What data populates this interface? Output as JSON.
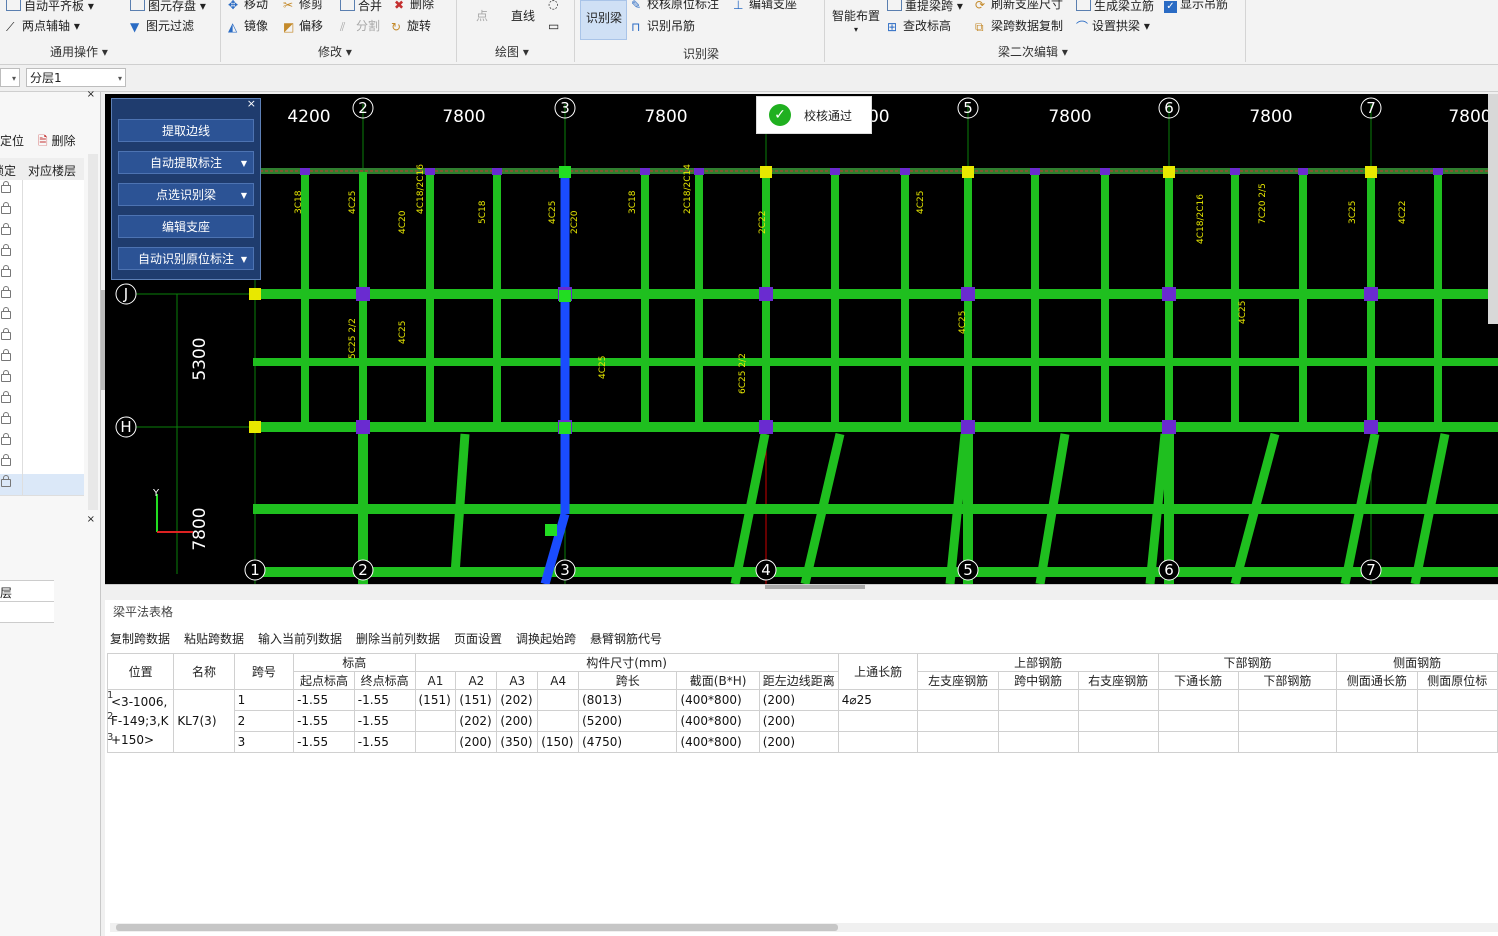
{
  "ribbon": {
    "groups": [
      {
        "label": "通用操作",
        "items": [
          "自动平齐板",
          "两点辅轴",
          "图元存盘",
          "图元过滤"
        ]
      },
      {
        "label": "修改",
        "items": [
          "移动",
          "修剪",
          "合并",
          "删除",
          "镜像",
          "偏移",
          "分割",
          "旋转"
        ]
      },
      {
        "label": "绘图",
        "items": [
          "点",
          "直线"
        ]
      },
      {
        "label": "识别梁",
        "items": [
          "识别梁",
          "校核原位标注",
          "编辑支座",
          "识别吊筋"
        ]
      },
      {
        "label": "梁二次编辑",
        "items": [
          "智能布置",
          "重提梁跨",
          "查改标高",
          "刷新支座尺寸",
          "梁跨数据复制",
          "生成梁立筋",
          "设置拱梁",
          "显示吊筋"
        ]
      }
    ]
  },
  "layer_combo": "分层1",
  "left_panel": {
    "btn_locate": "定位",
    "btn_delete": "删除",
    "col_lock": "锁定",
    "col_floor": "对应楼层",
    "lower_label": "层"
  },
  "tool_panel": {
    "buttons": [
      "提取边线",
      "自动提取标注",
      "点选识别梁",
      "编辑支座",
      "自动识别原位标注"
    ]
  },
  "toast": {
    "text": "校核通过"
  },
  "drawing": {
    "top_dims": [
      "4200",
      "7800",
      "7800",
      "7800",
      "7800",
      "7800",
      "7800"
    ],
    "top_axes": [
      "2",
      "3",
      "5",
      "6",
      "7"
    ],
    "bottom_axes": [
      "1",
      "2",
      "3",
      "4",
      "5",
      "6",
      "7"
    ],
    "row_axes": [
      "J",
      "H"
    ],
    "side_dims": [
      "5300",
      "7800"
    ]
  },
  "table": {
    "title": "梁平法表格",
    "actions": [
      "复制跨数据",
      "粘贴跨数据",
      "输入当前列数据",
      "删除当前列数据",
      "页面设置",
      "调换起始跨",
      "悬臂钢筋代号"
    ],
    "header_top": {
      "pos": "位置",
      "name": "名称",
      "span": "跨号",
      "elev": "标高",
      "size": "构件尺寸(mm)",
      "top_long": "上通长筋",
      "top_bar": "上部钢筋",
      "bot_bar": "下部钢筋",
      "side_bar": "侧面钢筋"
    },
    "header_sub": [
      "起点标高",
      "终点标高",
      "A1",
      "A2",
      "A3",
      "A4",
      "跨长",
      "截面(B*H)",
      "距左边线距离",
      "左支座钢筋",
      "跨中钢筋",
      "右支座钢筋",
      "下通长筋",
      "下部钢筋",
      "侧面通长筋",
      "侧面原位标"
    ],
    "position": [
      "<3-1006,",
      "F-149;3,K",
      "+150>"
    ],
    "name": "KL7(3)",
    "rows": [
      {
        "num": "1",
        "span": "1",
        "start": "-1.55",
        "end": "-1.55",
        "a1": "(151)",
        "a2": "(151)",
        "a3": "(202)",
        "a4": "",
        "len": "(8013)",
        "sec": "(400*800)",
        "dist": "(200)",
        "toplong": "4⌀25"
      },
      {
        "num": "2",
        "span": "2",
        "start": "-1.55",
        "end": "-1.55",
        "a1": "",
        "a2": "(202)",
        "a3": "(200)",
        "a4": "",
        "len": "(5200)",
        "sec": "(400*800)",
        "dist": "(200)",
        "toplong": ""
      },
      {
        "num": "3",
        "span": "3",
        "start": "-1.55",
        "end": "-1.55",
        "a1": "",
        "a2": "(200)",
        "a3": "(350)",
        "a4": "(150)",
        "len": "(4750)",
        "sec": "(400*800)",
        "dist": "(200)",
        "toplong": ""
      }
    ]
  },
  "colors": {
    "beam": "#1fbf1f",
    "grid": "#0a7f0a",
    "selected": "#1a4cff",
    "axis_red": "#cc0000",
    "panel": "#1f3c6e"
  }
}
